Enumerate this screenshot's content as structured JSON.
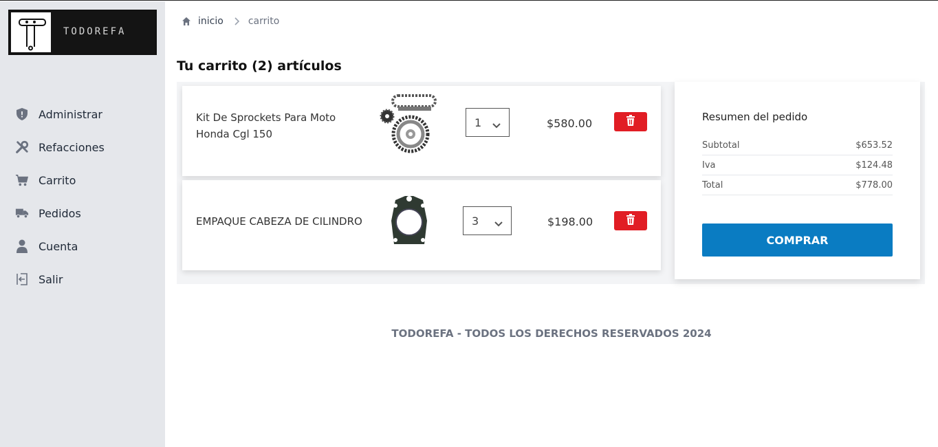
{
  "brand": {
    "name": "TODOREFA"
  },
  "sidebar": {
    "items": [
      {
        "label": "Administrar",
        "icon": "shield-icon"
      },
      {
        "label": "Refacciones",
        "icon": "tools-icon"
      },
      {
        "label": "Carrito",
        "icon": "cart-icon"
      },
      {
        "label": "Pedidos",
        "icon": "truck-icon"
      },
      {
        "label": "Cuenta",
        "icon": "user-icon"
      },
      {
        "label": "Salir",
        "icon": "logout-icon"
      }
    ]
  },
  "breadcrumb": {
    "home": "inicio",
    "current": "carrito"
  },
  "page": {
    "title": "Tu carrito (2) artículos"
  },
  "cart": {
    "items": [
      {
        "name": "Kit De Sprockets Para Moto Honda Cgl 150",
        "quantity": "1",
        "price": "$580.00",
        "image": "sprocket-kit-image"
      },
      {
        "name": "EMPAQUE CABEZA DE CILINDRO",
        "quantity": "3",
        "price": "$198.00",
        "image": "cylinder-gasket-image"
      }
    ]
  },
  "summary": {
    "title": "Resumen del pedido",
    "rows": [
      {
        "label": "Subtotal",
        "value": "$653.52"
      },
      {
        "label": "Iva",
        "value": "$124.48"
      },
      {
        "label": "Total",
        "value": "$778.00"
      }
    ],
    "buy_label": "COMPRAR"
  },
  "footer": {
    "text": "TODOREFA - TODOS LOS DERECHOS RESERVADOS 2024"
  },
  "colors": {
    "accent": "#0a7cc2",
    "danger": "#e11d24",
    "sidebar": "#e5e7eb"
  }
}
